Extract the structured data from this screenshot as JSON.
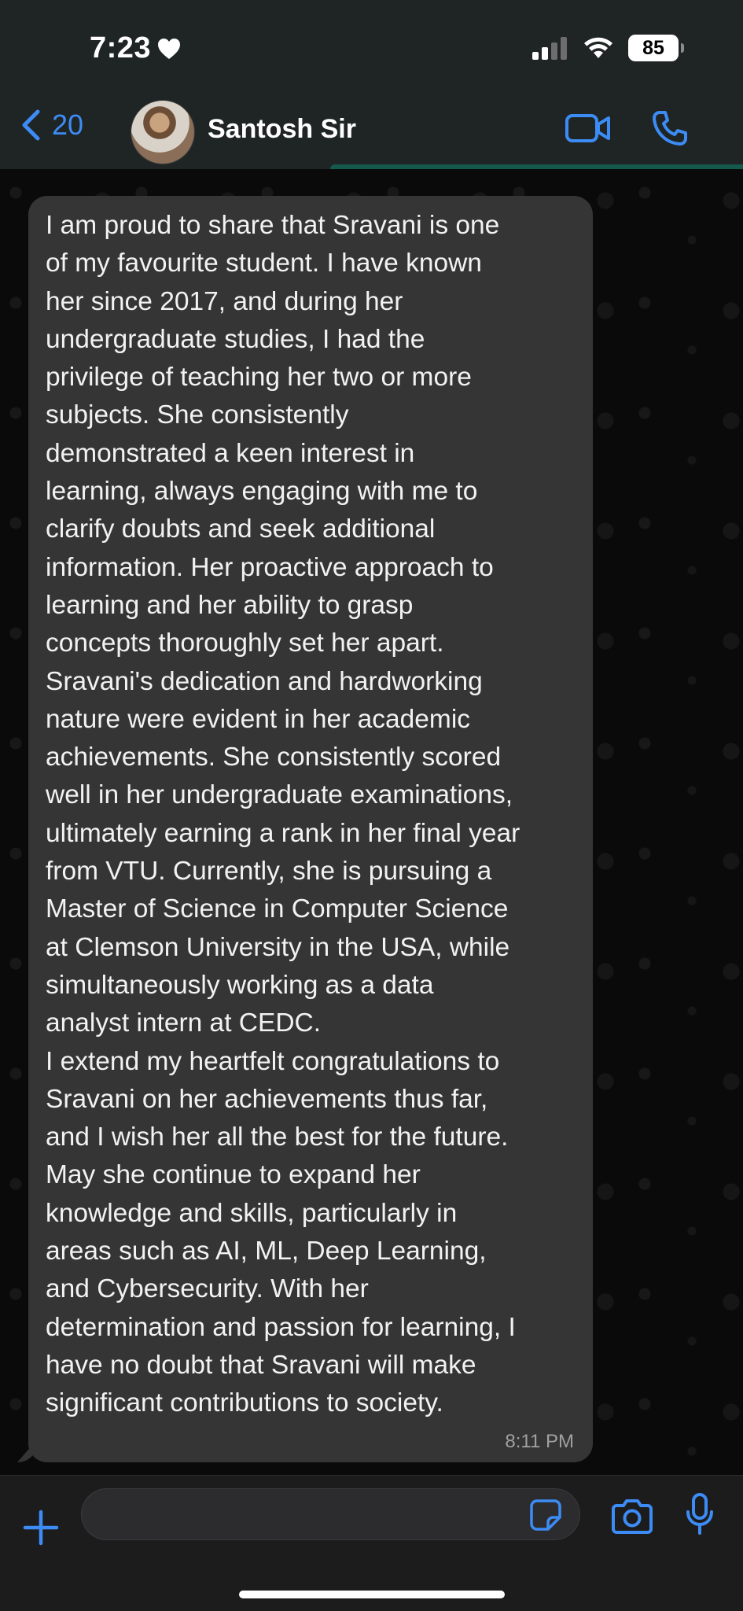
{
  "status_bar": {
    "time": "7:23",
    "heart_icon": "heart-icon",
    "battery_level": "85",
    "signal_icon": "signal-bars-icon",
    "wifi_icon": "wifi-icon"
  },
  "header": {
    "back_count": "20",
    "contact_name": "Santosh Sir",
    "icons": [
      "chevron-left-icon",
      "video-call-icon",
      "phone-call-icon"
    ]
  },
  "message": {
    "text": "I am proud to share that Sravani is one\nof my favourite student. I have known\nher since 2017, and during her\nundergraduate studies, I had the\nprivilege of teaching her two or more\nsubjects. She consistently\ndemonstrated a keen interest in\nlearning, always engaging with me to\nclarify doubts and seek additional\ninformation. Her proactive approach to\nlearning and her ability to grasp\nconcepts thoroughly set her apart.\nSravani's dedication and hardworking\nnature were evident in her academic\nachievements. She consistently scored\nwell in her undergraduate examinations,\nultimately earning a rank in her final year\nfrom VTU. Currently, she is pursuing a\nMaster of Science in Computer Science\nat Clemson University in the USA, while\nsimultaneously working as a data\nanalyst intern at CEDC.\nI extend my heartfelt congratulations to\nSravani on her achievements thus far,\nand I wish her all the best for the future.\nMay she continue to expand her\nknowledge and skills, particularly in\nareas such as AI, ML, Deep Learning,\nand Cybersecurity. With her\ndetermination and passion for learning, I\nhave no doubt that Sravani will make\nsignificant contributions to society.",
    "time": "8:11 PM"
  },
  "input_bar": {
    "placeholder": "",
    "icons": [
      "plus-icon",
      "sticker-icon",
      "camera-icon",
      "microphone-icon"
    ]
  },
  "colors": {
    "accent": "#3d8cf5",
    "bubble": "#353536",
    "header_bg": "#1e2524"
  }
}
